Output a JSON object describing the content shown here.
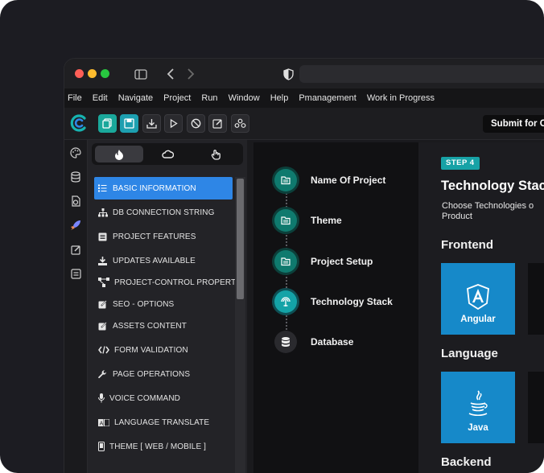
{
  "menubar": {
    "items": [
      "File",
      "Edit",
      "Navigate",
      "Project",
      "Run",
      "Window",
      "Help",
      "Pmanagement",
      "Work in Progress"
    ]
  },
  "toolbar": {
    "submit_label": "Submit for C"
  },
  "sidebar": {
    "items": [
      {
        "label": "BASIC INFORMATION",
        "icon": "list-icon",
        "active": true
      },
      {
        "label": "DB CONNECTION STRING",
        "icon": "sitemap-icon",
        "active": false
      },
      {
        "label": "PROJECT FEATURES",
        "icon": "feature-list-icon",
        "active": false
      },
      {
        "label": "UPDATES AVAILABLE",
        "icon": "download-icon",
        "active": false
      },
      {
        "label": "PROJECT-CONTROL PROPERTY",
        "icon": "control-nodes-icon",
        "active": false
      },
      {
        "label": "SEO - OPTIONS",
        "icon": "edit-icon",
        "active": false
      },
      {
        "label": "ASSETS CONTENT",
        "icon": "edit-icon",
        "active": false
      },
      {
        "label": "FORM VALIDATION",
        "icon": "code-icon",
        "active": false
      },
      {
        "label": "PAGE OPERATIONS",
        "icon": "wrench-icon",
        "active": false
      },
      {
        "label": "VOICE COMMAND",
        "icon": "microphone-icon",
        "active": false
      },
      {
        "label": "LANGUAGE TRANSLATE",
        "icon": "translate-icon",
        "active": false
      },
      {
        "label": "THEME [ WEB / MOBILE ]",
        "icon": "theme-icon",
        "active": false
      }
    ]
  },
  "steps": [
    {
      "label": "Name Of Project",
      "state": "done",
      "icon": "folder-icon"
    },
    {
      "label": "Theme",
      "state": "done",
      "icon": "folder-icon"
    },
    {
      "label": "Project Setup",
      "state": "done",
      "icon": "folder-icon"
    },
    {
      "label": "Technology Stack",
      "state": "current",
      "icon": "stack-icon"
    },
    {
      "label": "Database",
      "state": "pending",
      "icon": "database-icon"
    }
  ],
  "main": {
    "step_badge": "STEP 4",
    "title": "Technology Stac",
    "subtitle": "Choose Technologies o Product",
    "sections": [
      {
        "title": "Frontend",
        "card": "Angular"
      },
      {
        "title": "Language",
        "card": "Java"
      },
      {
        "title": "Backend"
      }
    ]
  },
  "colors": {
    "accent_blue": "#2e86e6",
    "teal": "#17a2a6",
    "card_blue": "#1689c9"
  }
}
